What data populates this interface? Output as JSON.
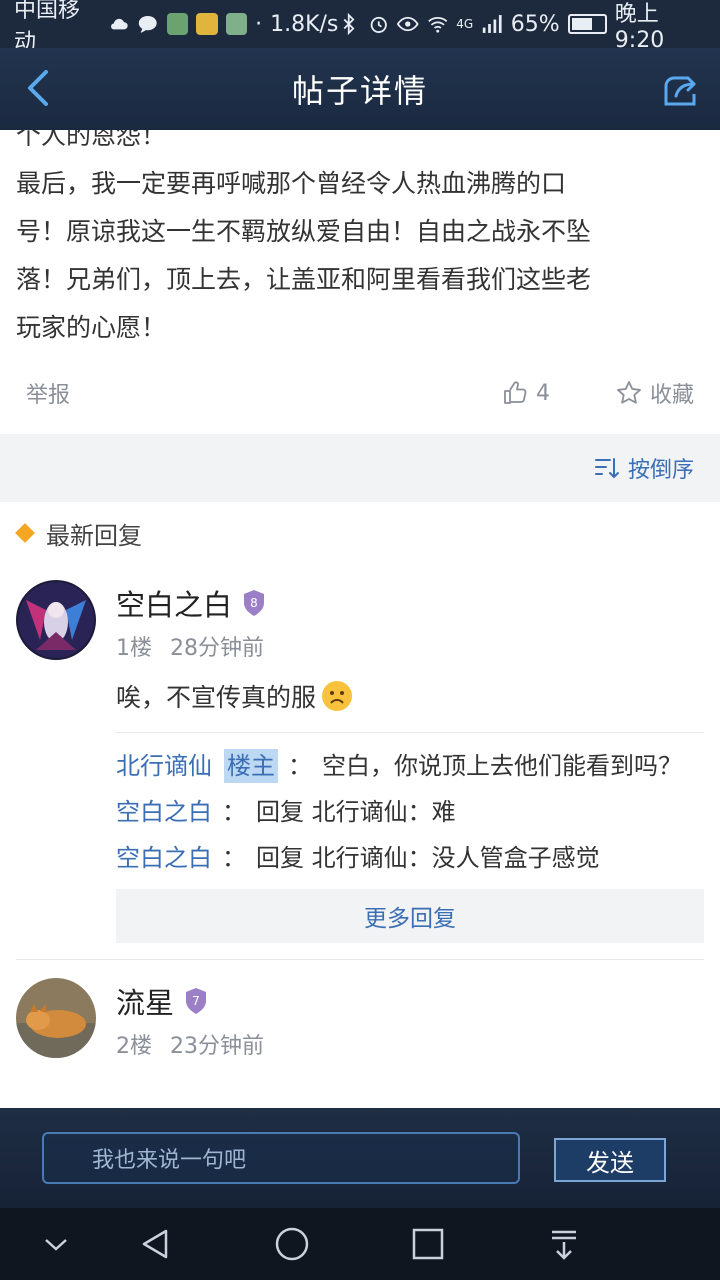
{
  "status_bar": {
    "carrier": "中国移动",
    "speed": "1.8K/s",
    "network": "4G",
    "battery": "65%",
    "battery_level": 0.65,
    "time": "晚上9:20"
  },
  "header": {
    "title": "帖子详情",
    "back_icon": "back-arrow-icon",
    "share_icon": "share-icon"
  },
  "post": {
    "cut_line": "个人的恩怨！",
    "lines": [
      "最后，我一定要再呼喊那个曾经令人热血沸腾的口",
      "号！原谅我这一生不羁放纵爱自由！自由之战永不坠",
      "落！兄弟们，顶上去，让盖亚和阿里看看我们这些老",
      "玩家的心愿！"
    ],
    "report_label": "举报",
    "like_count": "4",
    "favorite_label": "收藏"
  },
  "sort": {
    "label": "按倒序"
  },
  "section": {
    "title": "最新回复"
  },
  "replies": [
    {
      "username": "空白之白",
      "level": "8",
      "floor": "1楼",
      "time": "28分钟前",
      "text": "唉，不宣传真的服",
      "sub_replies": [
        {
          "user": "北行谪仙",
          "tag": "楼主",
          "text": "空白，你说顶上去他们能看到吗？"
        },
        {
          "user": "空白之白",
          "tag": "",
          "text": "回复 北行谪仙：难"
        },
        {
          "user": "空白之白",
          "tag": "",
          "text": "回复 北行谪仙：没人管盒子感觉"
        }
      ],
      "more_label": "更多回复"
    },
    {
      "username": "流星",
      "level": "7",
      "floor": "2楼",
      "time": "23分钟前"
    }
  ],
  "composer": {
    "placeholder": "我也来说一句吧",
    "send_label": "发送"
  },
  "colors": {
    "accent": "#3b6fb5",
    "header_bg": "#1a2940",
    "tag_bg": "#bcd8f3",
    "level_badge": "#9b7fc7"
  }
}
